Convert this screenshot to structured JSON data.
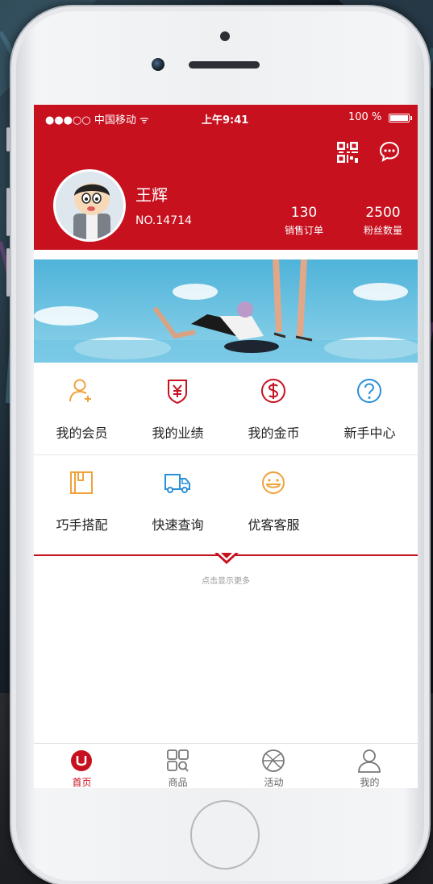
{
  "status_bar": {
    "carrier": "●●●○○ 中国移动 ᯤ",
    "time": "上午9:41",
    "battery": "100 %"
  },
  "profile": {
    "name": "王辉",
    "number": "NO.14714",
    "stats": [
      {
        "value": "130",
        "label": "销售订单"
      },
      {
        "value": "2500",
        "label": "粉丝数量"
      }
    ]
  },
  "menu": [
    {
      "label": "我的会员",
      "icon": "member-icon",
      "color": "#f0a23c"
    },
    {
      "label": "我的业绩",
      "icon": "yen-shield-icon",
      "color": "#c7111f"
    },
    {
      "label": "我的金币",
      "icon": "dollar-coin-icon",
      "color": "#c7111f"
    },
    {
      "label": "新手中心",
      "icon": "question-icon",
      "color": "#2a8fd6"
    },
    {
      "label": "巧手搭配",
      "icon": "box-icon",
      "color": "#f0a23c"
    },
    {
      "label": "快速查询",
      "icon": "truck-icon",
      "color": "#2a8fd6"
    },
    {
      "label": "优客客服",
      "icon": "smile-icon",
      "color": "#f0a23c"
    }
  ],
  "show_more": "点击显示更多",
  "tabs": [
    {
      "label": "首页",
      "icon": "home-u-icon",
      "active": true
    },
    {
      "label": "商品",
      "icon": "grid-search-icon",
      "active": false
    },
    {
      "label": "活动",
      "icon": "ball-icon",
      "active": false
    },
    {
      "label": "我的",
      "icon": "user-icon",
      "active": false
    }
  ],
  "colors": {
    "brand": "#c7111f",
    "accent_orange": "#f0a23c",
    "accent_blue": "#2a8fd6"
  }
}
